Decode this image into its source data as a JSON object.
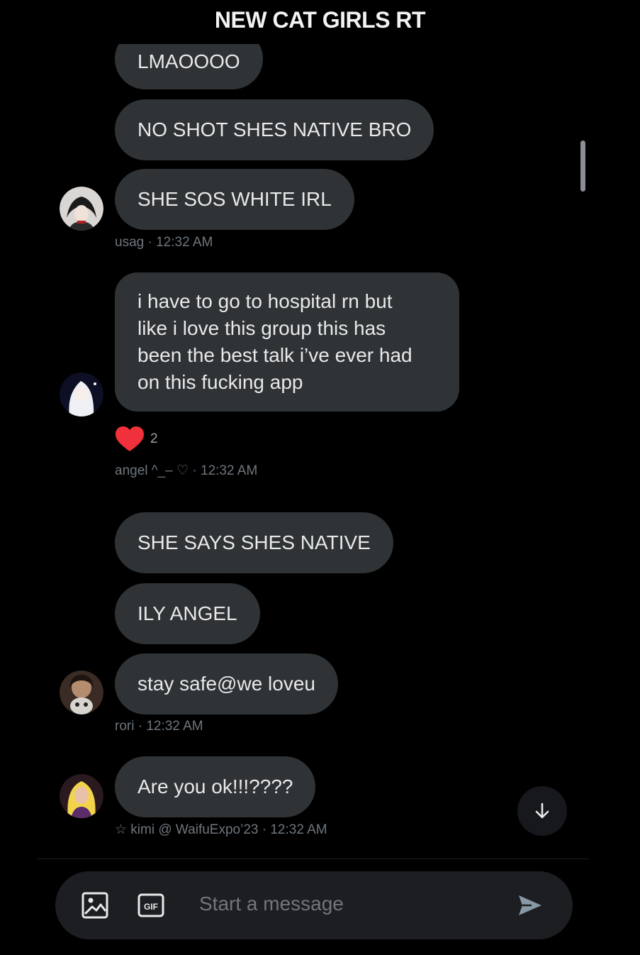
{
  "header": {
    "title": "NEW CAT GIRLS RT"
  },
  "messages": [
    {
      "text": "LMAOOOO"
    },
    {
      "text": "NO SHOT SHES NATIVE BRO"
    },
    {
      "text": "SHE SOS WHITE IRL"
    },
    {
      "meta": "usag · 12:32 AM"
    },
    {
      "text_lines": [
        "i have to go to hospital rn but",
        "like i love this group this has",
        "been the best talk i’ve ever had",
        "on this fucking app"
      ]
    },
    {
      "reaction_count": "2",
      "meta": "angel ^_– ♡ · 12:32 AM"
    },
    {
      "text": "SHE SAYS SHES NATIVE"
    },
    {
      "text": "ILY ANGEL"
    },
    {
      "text": "stay safe@we loveu",
      "meta": "rori · 12:32 AM"
    },
    {
      "text": "Are you ok!!!????",
      "meta": "☆ kimi @ WaifuExpo’23 · 12:32 AM"
    }
  ],
  "icons": {
    "reaction": "heart-icon",
    "scroll_down": "arrow-down-icon",
    "image": "image-icon",
    "gif": "gif-icon",
    "send": "send-icon"
  },
  "composer": {
    "placeholder": "Start a message"
  },
  "colors": {
    "background": "#000000",
    "bubble": "#2f3336",
    "heart": "#f0303a",
    "send": "#8899a6"
  }
}
